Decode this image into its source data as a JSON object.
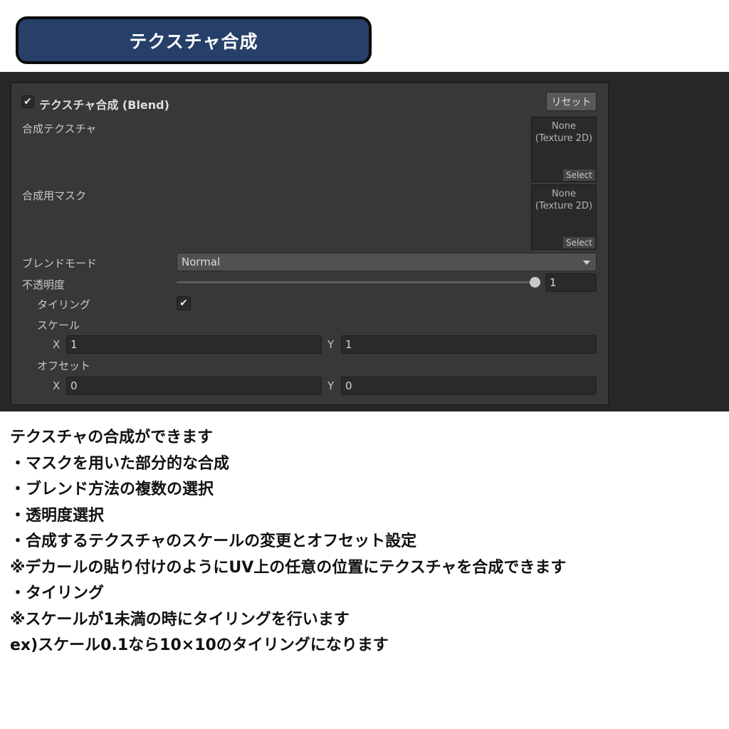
{
  "header": {
    "title": "テクスチャ合成"
  },
  "inspector": {
    "component_title": "テクスチャ合成 (Blend)",
    "enabled": true,
    "reset_label": "リセット",
    "blend_texture": {
      "label": "合成テクスチャ",
      "slot_text": "None\n(Texture 2D)",
      "select_label": "Select"
    },
    "mask_texture": {
      "label": "合成用マスク",
      "slot_text": "None\n(Texture 2D)",
      "select_label": "Select"
    },
    "blend_mode": {
      "label": "ブレンドモード",
      "value": "Normal"
    },
    "opacity": {
      "label": "不透明度",
      "value": "1",
      "level": 1.0
    },
    "tiling": {
      "label": "タイリング",
      "checked": true
    },
    "scale": {
      "label": "スケール",
      "x_label": "X",
      "x_value": "1",
      "y_label": "Y",
      "y_value": "1"
    },
    "offset": {
      "label": "オフセット",
      "x_label": "X",
      "x_value": "0",
      "y_label": "Y",
      "y_value": "0"
    }
  },
  "description": {
    "lines": [
      "テクスチャの合成ができます",
      "・マスクを用いた部分的な合成",
      "・ブレンド方法の複数の選択",
      "・透明度選択",
      "・合成するテクスチャのスケールの変更とオフセット設定",
      "※デカールの貼り付けのようにUV上の任意の位置にテクスチャを合成できます",
      "・タイリング",
      "※スケールが1未満の時にタイリングを行います",
      "ex)スケール0.1なら10×10のタイリングになります"
    ]
  },
  "colors": {
    "title_bg": "#26406a",
    "inspector_bg": "#383838",
    "band_bg": "#282828"
  }
}
